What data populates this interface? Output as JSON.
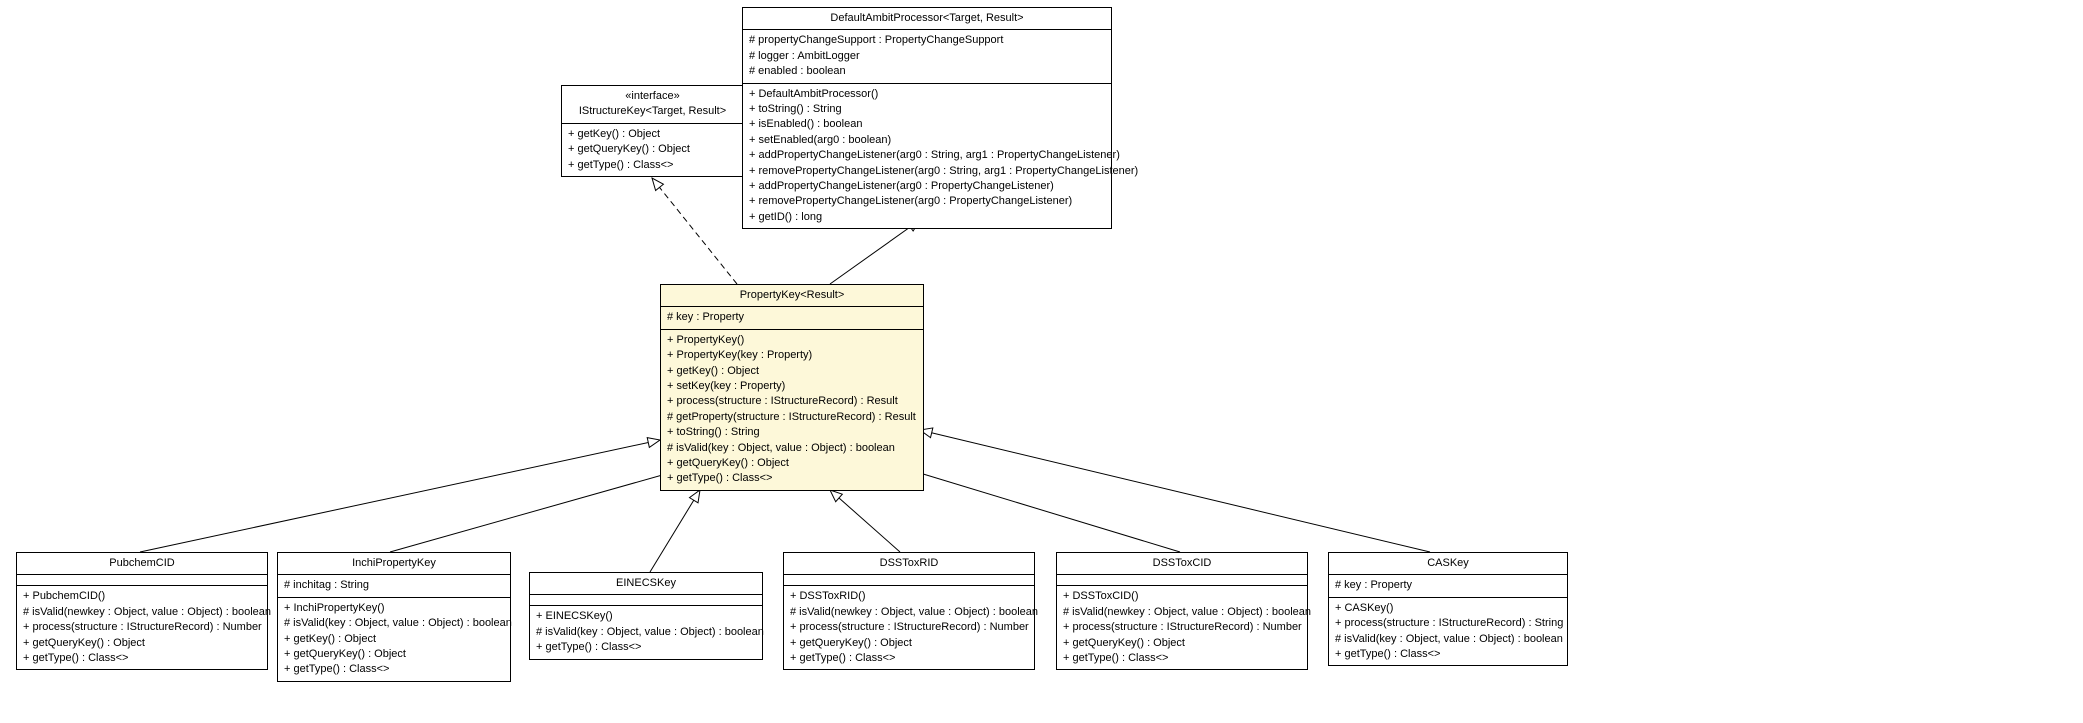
{
  "istructurekey": {
    "stereo": "«interface»",
    "title": "IStructureKey<Target, Result>",
    "methods": [
      "+ getKey() : Object",
      "+ getQueryKey() : Object",
      "+ getType() : Class<>"
    ]
  },
  "defaultambit": {
    "title": "DefaultAmbitProcessor<Target, Result>",
    "attrs": [
      "# propertyChangeSupport : PropertyChangeSupport",
      "# logger : AmbitLogger",
      "# enabled : boolean"
    ],
    "methods": [
      "+ DefaultAmbitProcessor()",
      "+ toString() : String",
      "+ isEnabled() : boolean",
      "+ setEnabled(arg0 : boolean)",
      "+ addPropertyChangeListener(arg0 : String, arg1 : PropertyChangeListener)",
      "+ removePropertyChangeListener(arg0 : String, arg1 : PropertyChangeListener)",
      "+ addPropertyChangeListener(arg0 : PropertyChangeListener)",
      "+ removePropertyChangeListener(arg0 : PropertyChangeListener)",
      "+ getID() : long"
    ]
  },
  "propertykey": {
    "title": "PropertyKey<Result>",
    "attrs": [
      "# key : Property"
    ],
    "methods": [
      "+ PropertyKey()",
      "+ PropertyKey(key : Property)",
      "+ getKey() : Object",
      "+ setKey(key : Property)",
      "+ process(structure : IStructureRecord) : Result",
      "# getProperty(structure : IStructureRecord) : Result",
      "+ toString() : String",
      "# isValid(key : Object, value : Object) : boolean",
      "+ getQueryKey() : Object",
      "+ getType() : Class<>"
    ]
  },
  "pubchemcid": {
    "title": "PubchemCID",
    "methods": [
      "+ PubchemCID()",
      "# isValid(newkey : Object, value : Object) : boolean",
      "+ process(structure : IStructureRecord) : Number",
      "+ getQueryKey() : Object",
      "+ getType() : Class<>"
    ]
  },
  "inchipropertykey": {
    "title": "InchiPropertyKey",
    "attrs": [
      "# inchitag : String"
    ],
    "methods": [
      "+ InchiPropertyKey()",
      "# isValid(key : Object, value : Object) : boolean",
      "+ getKey() : Object",
      "+ getQueryKey() : Object",
      "+ getType() : Class<>"
    ]
  },
  "einecskey": {
    "title": "EINECSKey",
    "methods": [
      "+ EINECSKey()",
      "# isValid(key : Object, value : Object) : boolean",
      "+ getType() : Class<>"
    ]
  },
  "dsstoxrid": {
    "title": "DSSToxRID",
    "methods": [
      "+ DSSToxRID()",
      "# isValid(newkey : Object, value : Object) : boolean",
      "+ process(structure : IStructureRecord) : Number",
      "+ getQueryKey() : Object",
      "+ getType() : Class<>"
    ]
  },
  "dsstoxcid": {
    "title": "DSSToxCID",
    "methods": [
      "+ DSSToxCID()",
      "# isValid(newkey : Object, value : Object) : boolean",
      "+ process(structure : IStructureRecord) : Number",
      "+ getQueryKey() : Object",
      "+ getType() : Class<>"
    ]
  },
  "caskey": {
    "title": "CASKey",
    "attrs": [
      "# key : Property"
    ],
    "methods": [
      "+ CASKey()",
      "+ process(structure : IStructureRecord) : String",
      "# isValid(key : Object, value : Object) : boolean",
      "+ getType() : Class<>"
    ]
  }
}
